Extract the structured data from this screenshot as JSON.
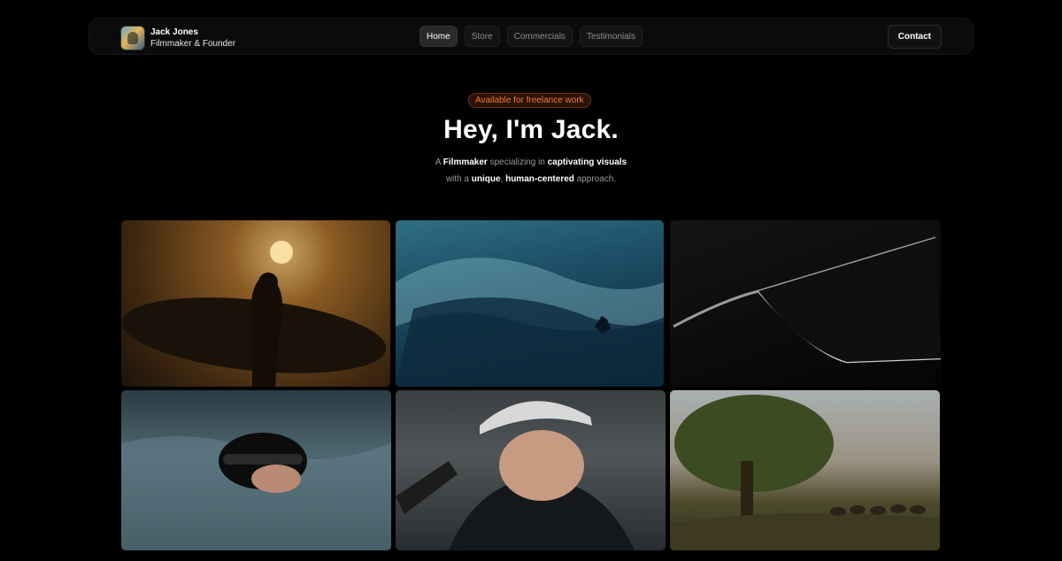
{
  "header": {
    "name": "Jack Jones",
    "role": "Filmmaker & Founder",
    "nav": [
      "Home",
      "Store",
      "Commercials",
      "Testimonials"
    ],
    "active_nav": "Home",
    "contact_label": "Contact"
  },
  "hero": {
    "badge": "Available for freelance work",
    "title": "Hey, I'm Jack.",
    "line1": {
      "p1": "A ",
      "b1": "Filmmaker",
      "p2": " specializing in ",
      "b2": "captivating visuals"
    },
    "line2": {
      "p1": "with a ",
      "b1": "unique",
      "p2": ", ",
      "b2": "human-centered",
      "p3": " approach."
    }
  },
  "gallery": [
    {
      "name": "surfer-silhouette-sunset"
    },
    {
      "name": "surfer-inside-wave"
    },
    {
      "name": "car-window-detail"
    },
    {
      "name": "swimmer-in-water"
    },
    {
      "name": "cyclist-with-helmet"
    },
    {
      "name": "savanna-tree-with-herd"
    }
  ],
  "colors": {
    "background": "#000000",
    "badge_text": "#f07a3a",
    "badge_bg": "#2a1206"
  }
}
